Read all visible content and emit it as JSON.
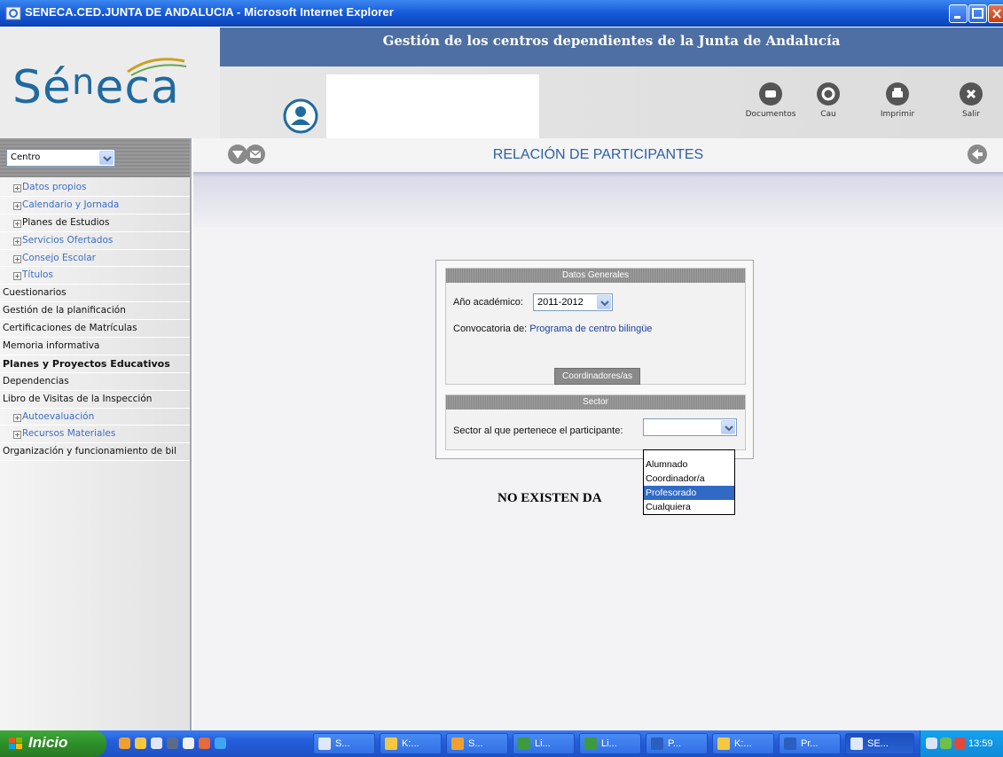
{
  "window": {
    "title": "SENECA.CED.JUNTA DE ANDALUCIA - Microsoft Internet Explorer"
  },
  "header": {
    "banner": "Gestión de los centros dependientes de la Junta de Andalucía",
    "logo_main": "Sé",
    "logo_sup": "n",
    "logo_tail": "eca",
    "tools": [
      {
        "label": "Documentos",
        "icon": "documents-icon"
      },
      {
        "label": "Cau",
        "icon": "cau-icon"
      },
      {
        "label": "Imprimir",
        "icon": "print-icon"
      },
      {
        "label": "Salir",
        "icon": "exit-icon"
      }
    ]
  },
  "sidebar": {
    "centro_select": "Centro",
    "items": [
      {
        "label": "Datos propios",
        "expandable": true
      },
      {
        "label": "Calendario y Jornada",
        "expandable": true
      },
      {
        "label": "Planes de Estudios",
        "expandable": true
      },
      {
        "label": "Servicios Ofertados",
        "expandable": true
      },
      {
        "label": "Consejo Escolar",
        "expandable": true
      },
      {
        "label": "Títulos",
        "expandable": true
      },
      {
        "label": "Cuestionarios",
        "expandable": false
      },
      {
        "label": "Gestión de la planificación",
        "expandable": false
      },
      {
        "label": "Certificaciones de Matrículas",
        "expandable": false
      },
      {
        "label": "Memoria informativa",
        "expandable": false
      },
      {
        "label": "Planes y Proyectos Educativos",
        "expandable": false,
        "bold": true
      },
      {
        "label": "Dependencias",
        "expandable": false
      },
      {
        "label": "Libro de Visitas de la Inspección",
        "expandable": false
      },
      {
        "label": "Autoevaluación",
        "expandable": true
      },
      {
        "label": "Recursos Materiales",
        "expandable": true
      },
      {
        "label": "Organización y funcionamiento de bil",
        "expandable": false
      }
    ]
  },
  "main": {
    "title": "RELACIÓN DE PARTICIPANTES",
    "datos_generales": {
      "heading": "Datos Generales",
      "year_label": "Año académico:",
      "year_value": "2011-2012",
      "convocatoria_label": "Convocatoria de:",
      "convocatoria_value": "Programa de centro bilingüe",
      "button": "Coordinadores/as"
    },
    "sector": {
      "heading": "Sector",
      "label": "Sector al que pertenece el participante:",
      "value": "",
      "options": [
        "Alumnado",
        "Coordinador/a",
        "Profesorado",
        "Cualquiera"
      ],
      "highlighted": "Profesorado"
    },
    "no_data": "NO EXISTEN DA"
  },
  "taskbar": {
    "start": "Inicio",
    "tasks": [
      "S...",
      "K:...",
      "S...",
      "Li...",
      "Li...",
      "P...",
      "K:...",
      "Pr...",
      "SE..."
    ],
    "clock": "13:59"
  },
  "colors": {
    "banner_blue": "#4d6fa3",
    "title_blue": "#2c5fa8",
    "link_blue": "#3d6ec4",
    "highlight": "#316ac5"
  }
}
